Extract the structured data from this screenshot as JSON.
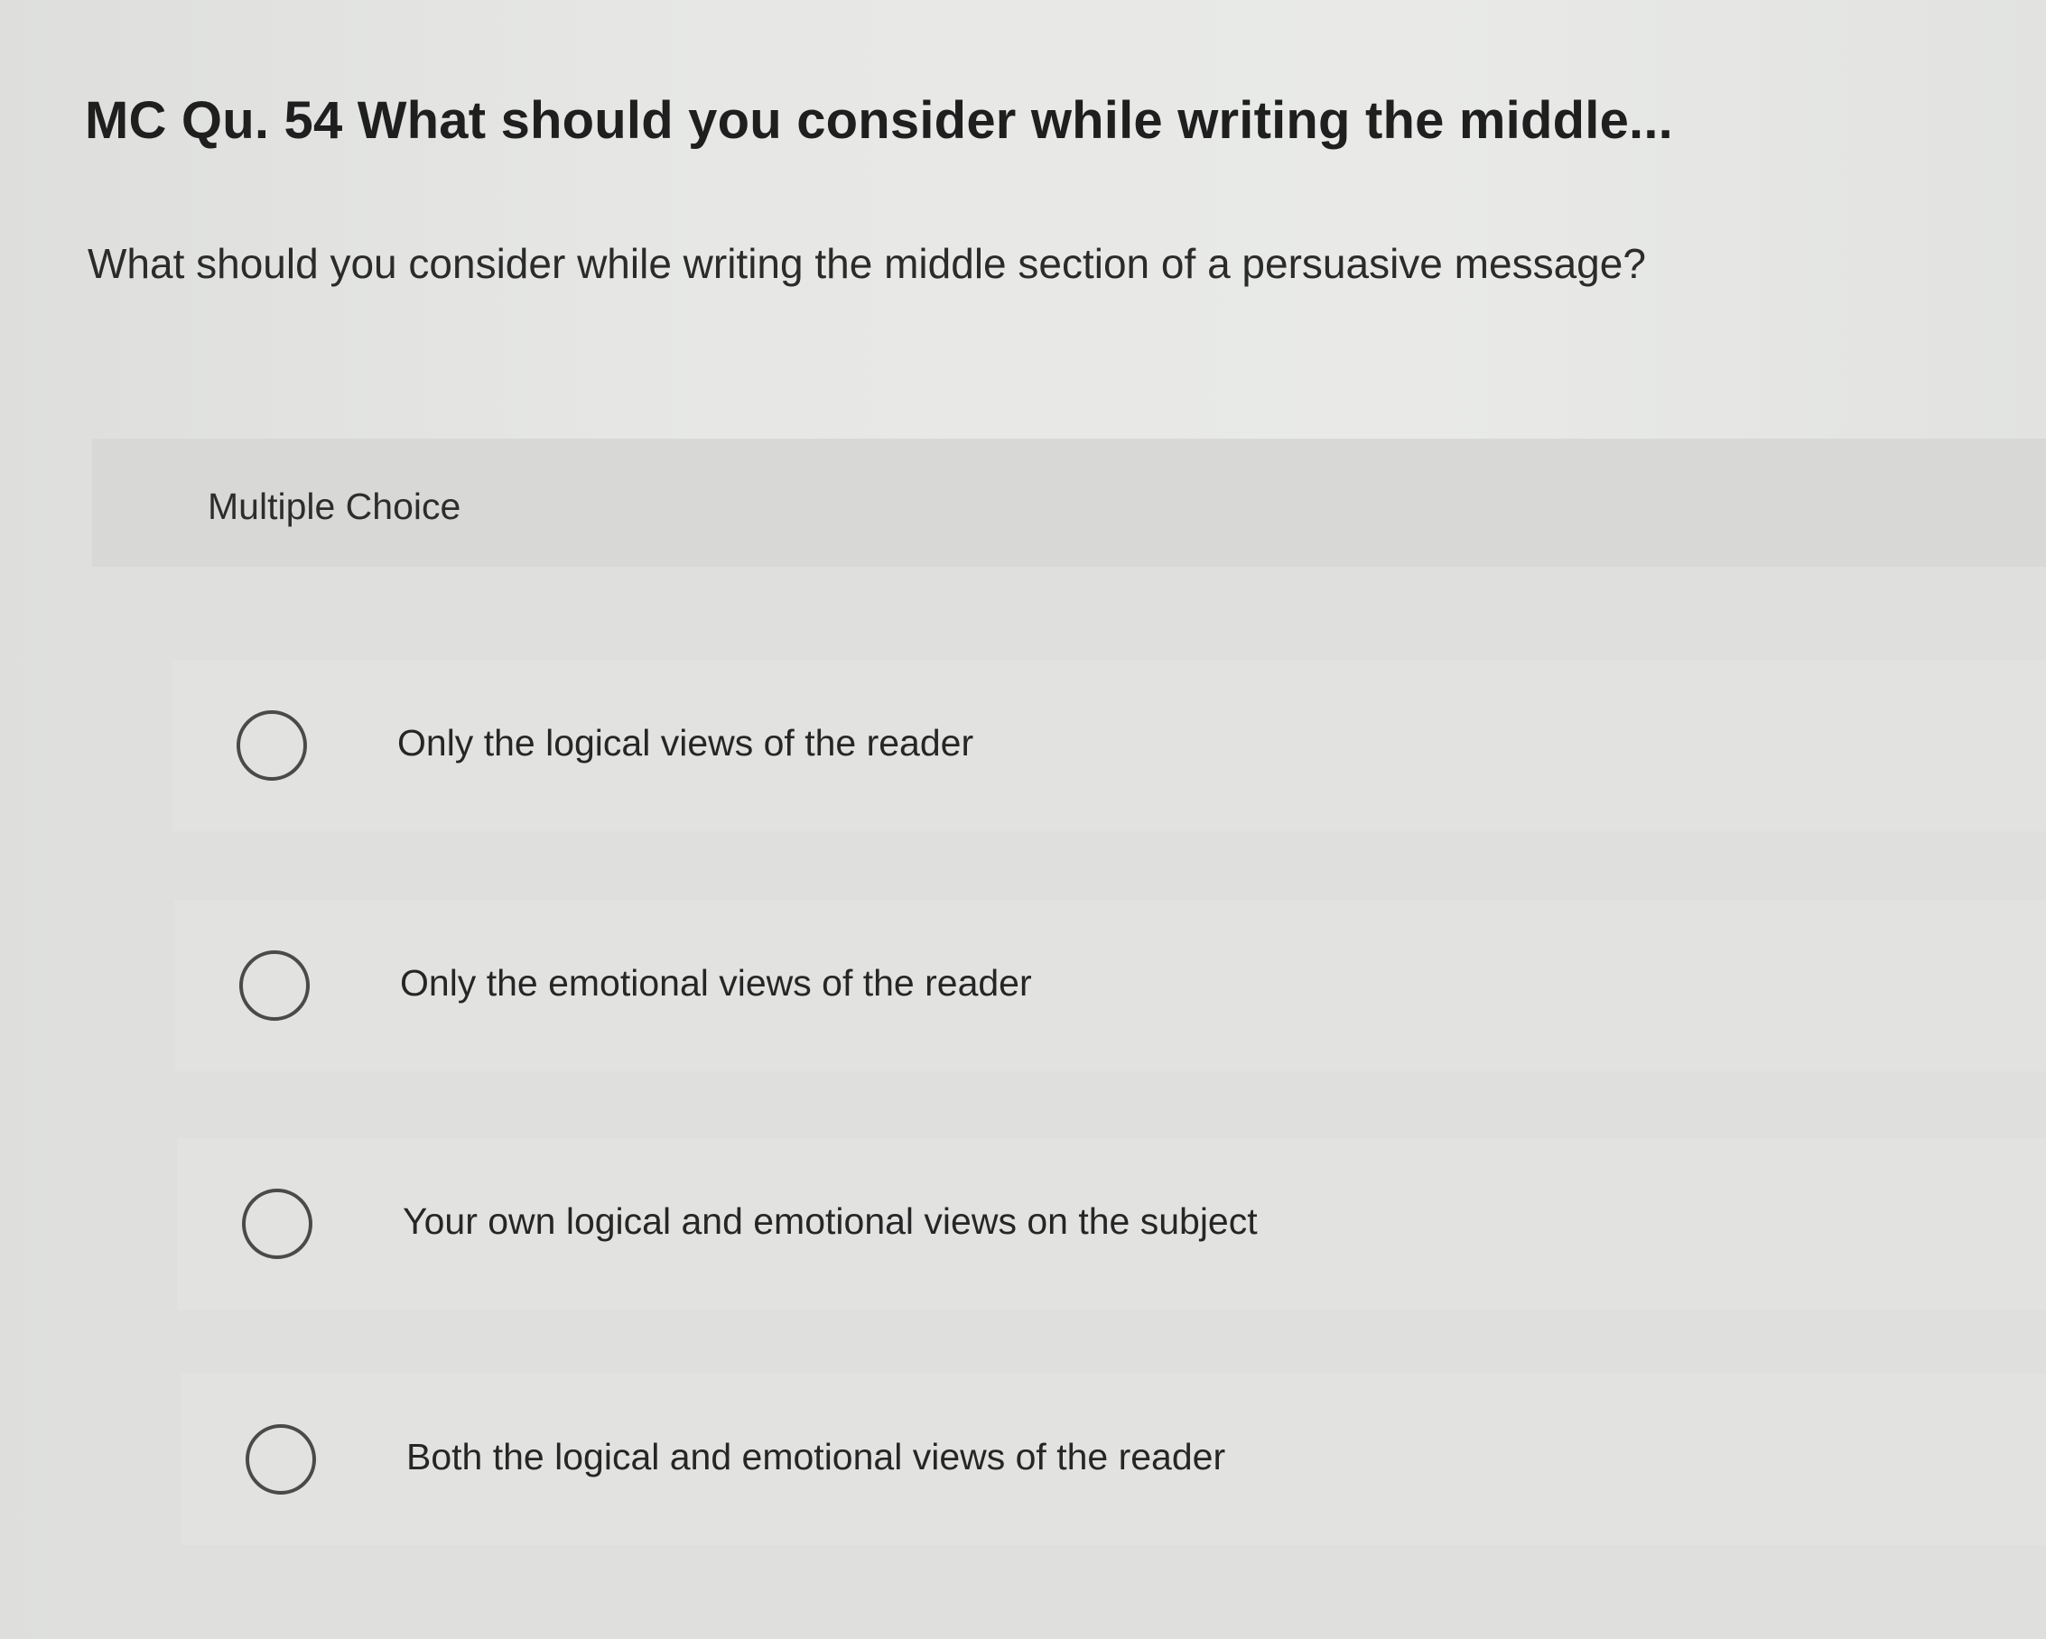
{
  "question": {
    "title": "MC Qu. 54 What should you consider while writing the middle...",
    "prompt": "What should you consider while writing the middle section of a persuasive message?"
  },
  "answer_panel": {
    "label": "Multiple Choice",
    "options": [
      {
        "label": "Only the logical views of the reader",
        "selected": false
      },
      {
        "label": "Only the emotional views of the reader",
        "selected": false
      },
      {
        "label": "Your own logical and emotional views on the subject",
        "selected": false
      },
      {
        "label": "Both the logical and emotional views of the reader",
        "selected": false
      }
    ]
  },
  "icons": {
    "radio": "radio-unchecked-icon"
  }
}
